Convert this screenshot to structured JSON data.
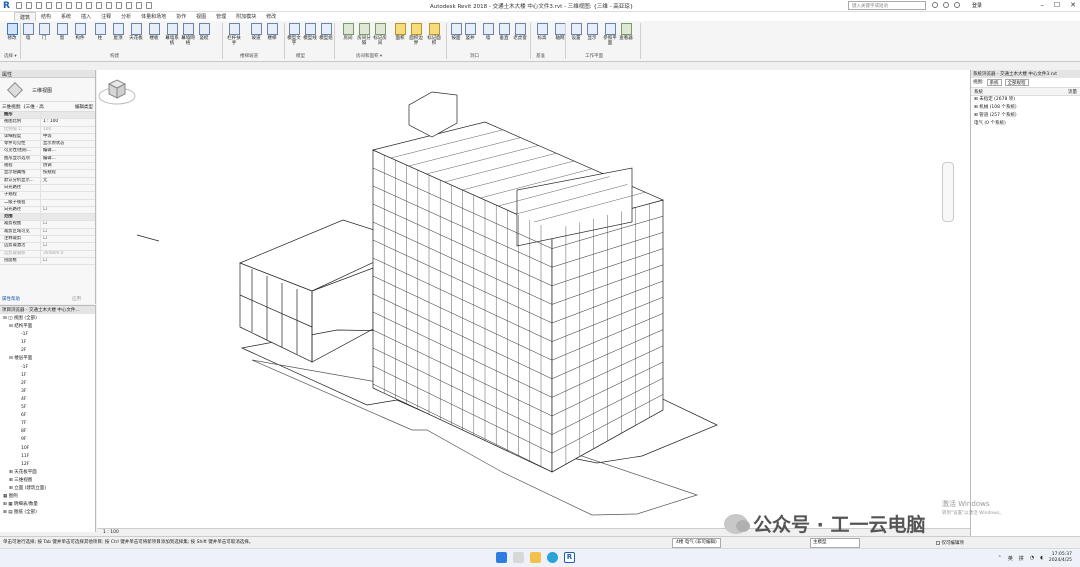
{
  "window": {
    "title": "Autodesk Revit 2018 -     交通土木大楼 中心文件3.rvt - 三维视图: {三维 - 高亚琼}",
    "search_placeholder": "键入关键字或短语",
    "login": "登录"
  },
  "ribbon": {
    "tabs": [
      "建筑",
      "结构",
      "系统",
      "插入",
      "注释",
      "分析",
      "体量和场地",
      "协作",
      "视图",
      "管理",
      "附加模块",
      "修改"
    ],
    "active_tab": 0,
    "buttons": [
      "修改",
      "墙",
      "门",
      "窗",
      "构件",
      "柱",
      "屋顶",
      "天花板",
      "楼板",
      "幕墙系统",
      "幕墙网格",
      "竖梃",
      "栏杆扶手",
      "坡道",
      "楼梯",
      "模型文字",
      "模型线",
      "模型组",
      "房间",
      "房间分隔",
      "标记房间",
      "面积",
      "面积边界",
      "标记面积",
      "按面",
      "竖井",
      "墙",
      "垂直",
      "老虎窗",
      "标高",
      "轴网",
      "设置",
      "显示",
      "参照平面",
      "查看器"
    ],
    "panels": [
      "选择 ▾",
      "构建",
      "楼梯坡道",
      "模型",
      "房间和面积 ▾",
      "洞口",
      "基准",
      "工作平面"
    ]
  },
  "properties": {
    "header": "属性",
    "type_name": "三维视图",
    "view_selector": "三维视图: {三维 - 高",
    "edit_type": "编辑类型",
    "rows": [
      {
        "k": "图形",
        "v": "",
        "group": true
      },
      {
        "k": "视图比例",
        "v": "1 : 100"
      },
      {
        "k": "比例值 1:",
        "v": "100",
        "dim": true
      },
      {
        "k": "详细程度",
        "v": "中等"
      },
      {
        "k": "零件可见性",
        "v": "显示原状态"
      },
      {
        "k": "可见性/图形...",
        "v": "编辑..."
      },
      {
        "k": "图形显示选项",
        "v": "编辑..."
      },
      {
        "k": "规程",
        "v": "协调"
      },
      {
        "k": "显示隐藏线",
        "v": "按规程"
      },
      {
        "k": "默认分析显示...",
        "v": "无"
      },
      {
        "k": "日光路径",
        "v": ""
      },
      {
        "k": "子规程",
        "v": ""
      },
      {
        "k": "二级子规程",
        "v": ""
      },
      {
        "k": "日光路径",
        "v": "☐"
      },
      {
        "k": "范围",
        "v": "",
        "group": true
      },
      {
        "k": "裁剪视图",
        "v": "☐"
      },
      {
        "k": "裁剪区域可见",
        "v": "☐"
      },
      {
        "k": "注释裁剪",
        "v": "☐"
      },
      {
        "k": "远剪裁激活",
        "v": "☐"
      },
      {
        "k": "远剪裁偏移",
        "v": "304800.0",
        "dim": true
      },
      {
        "k": "剖面框",
        "v": "☐"
      }
    ],
    "help_link": "属性帮助",
    "apply": "应用"
  },
  "project_browser": {
    "header": "项目浏览器 - 交通土木大楼 中心文件...",
    "nodes": [
      {
        "t": "⊟ ◫ 视图 (全部)",
        "d": 0
      },
      {
        "t": "⊟ 结构平面",
        "d": 1
      },
      {
        "t": "-1F",
        "d": 3
      },
      {
        "t": "1F",
        "d": 3
      },
      {
        "t": "2F",
        "d": 3
      },
      {
        "t": "⊟ 楼层平面",
        "d": 1
      },
      {
        "t": "-1F",
        "d": 3
      },
      {
        "t": "1F",
        "d": 3
      },
      {
        "t": "2F",
        "d": 3
      },
      {
        "t": "3F",
        "d": 3
      },
      {
        "t": "4F",
        "d": 3
      },
      {
        "t": "5F",
        "d": 3
      },
      {
        "t": "6F",
        "d": 3
      },
      {
        "t": "7F",
        "d": 3
      },
      {
        "t": "8F",
        "d": 3
      },
      {
        "t": "9F",
        "d": 3
      },
      {
        "t": "10F",
        "d": 3
      },
      {
        "t": "11F",
        "d": 3
      },
      {
        "t": "12F",
        "d": 3
      },
      {
        "t": "⊞ 天花板平面",
        "d": 1
      },
      {
        "t": "⊞ 三维视图",
        "d": 1
      },
      {
        "t": "⊞ 立面 (建筑立面)",
        "d": 1
      },
      {
        "t": "▦ 图例",
        "d": 0
      },
      {
        "t": "⊞ ▦ 明细表/数量",
        "d": 0
      },
      {
        "t": "⊞ ▤ 图纸 (全部)",
        "d": 0
      }
    ]
  },
  "view_control_bar": {
    "scale": "1 : 100"
  },
  "system_browser": {
    "header": "系统浏览器 - 交通土木大楼 中心文件3.rvt",
    "view_label": "视图:",
    "view_value": "系统",
    "discipline_value": "全部规程",
    "col_system": "系统",
    "col_flow": "流量",
    "rows": [
      "⊞ 未指定 (2678 项)",
      "⊞ 机械 (108 个系统)",
      "⊞ 管道 (257 个系统)",
      "  电气 (0 个系统)"
    ]
  },
  "status_bar": {
    "hint": "单击可进行选择; 按 Tab 键并单击可选择其他项目; 按 Ctrl 键并单击可将新项目添加到选择集; 按 Shift 键并单击可取消选择。",
    "workset": "4楼 电气 (非可编辑)",
    "filter": "主模型",
    "editable_only": "仅可编辑项"
  },
  "overlay": {
    "activate_line1": "激活 Windows",
    "activate_line2": "转到\"设置\"以激活 Windows。",
    "watermark": "公众号 · 工一云电脑"
  },
  "taskbar": {
    "lang": "英",
    "ime": "拼",
    "time": "17:05:37",
    "date": "2024/4/25"
  }
}
